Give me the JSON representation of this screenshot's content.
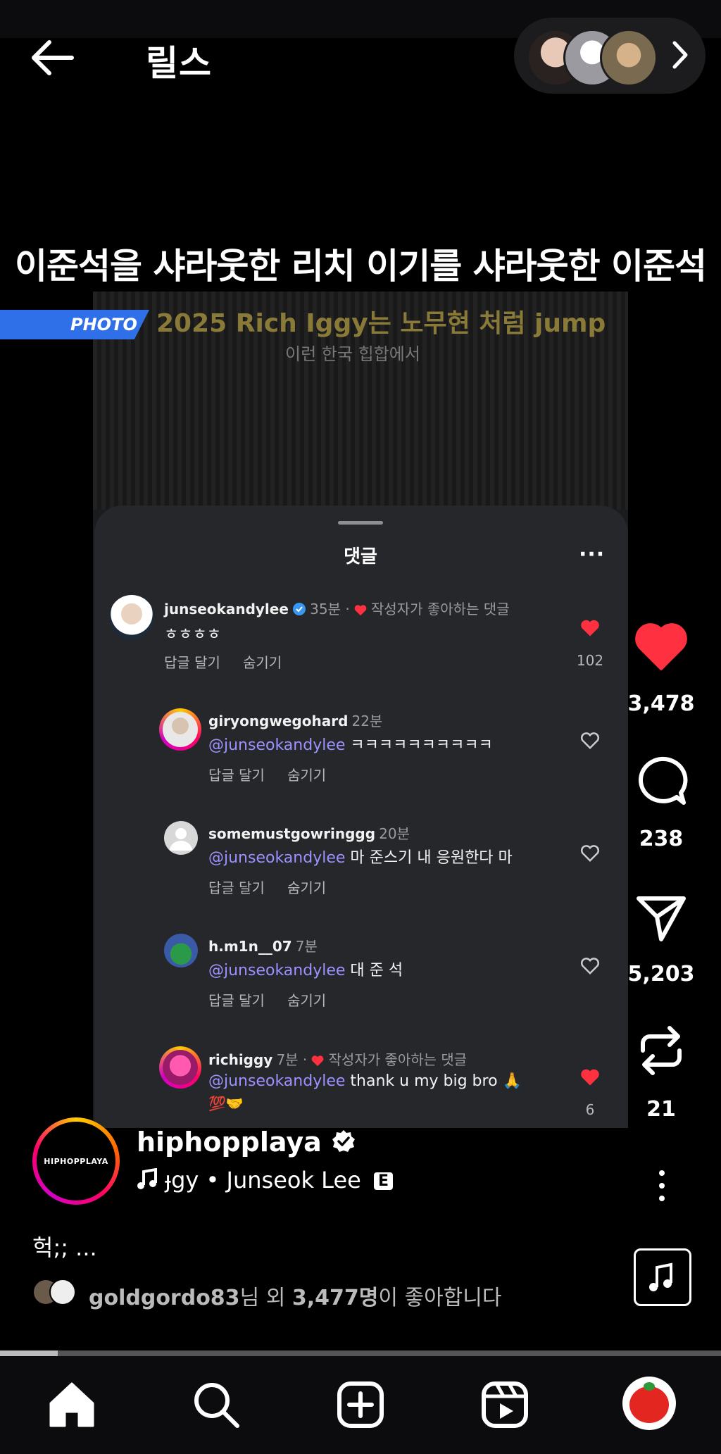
{
  "header": {
    "title": "릴스",
    "back_icon": "arrow-left-icon",
    "chevron_icon": "chevron-right-icon"
  },
  "headline": "이준석을 샤라웃한 리치 이기를 샤라웃한 이준석",
  "video": {
    "photo_tag": "PHOTO",
    "overlay_line1": "2025 Rich Iggy는 노무현 처럼 jump",
    "overlay_line2": "이런 한국 힙합에서"
  },
  "comments_sheet": {
    "title": "댓글",
    "more_label": "···",
    "comments": [
      {
        "user": "junseokandylee",
        "time": "35분 ·",
        "liked_by_creator": "작성자가 좋아하는 댓글",
        "mention": "",
        "text": "ㅎㅎㅎㅎ",
        "reply": "답글 달기",
        "hide": "숨기기",
        "likes": "102"
      },
      {
        "user": "giryongwegohard",
        "time": "22분",
        "liked_by_creator": "",
        "mention": "@junseokandylee",
        "text": "ㅋㅋㅋㅋㅋㅋㅋㅋㅋㅋ",
        "reply": "답글 달기",
        "hide": "숨기기",
        "likes": ""
      },
      {
        "user": "somemustgowringgg",
        "time": "20분",
        "liked_by_creator": "",
        "mention": "@junseokandylee",
        "text": "마 준스기 내 응원한다 마",
        "reply": "답글 달기",
        "hide": "숨기기",
        "likes": ""
      },
      {
        "user": "h.m1n__07",
        "time": "7분",
        "liked_by_creator": "",
        "mention": "@junseokandylee",
        "text": "대 준 석",
        "reply": "답글 달기",
        "hide": "숨기기",
        "likes": ""
      },
      {
        "user": "richiggy",
        "time": "7분 ·",
        "liked_by_creator": "작성자가 좋아하는 댓글",
        "mention": "@junseokandylee",
        "text": "thank u my big bro 🙏",
        "text2": "💯🤝",
        "reply": "",
        "hide": "",
        "likes": "6"
      }
    ]
  },
  "rail": {
    "likes": "3,478",
    "comments": "238",
    "shares": "5,203",
    "reposts": "21"
  },
  "post": {
    "channel_logo": "HIPHOPPLAYA",
    "channel": "hiphopplaya",
    "music": "ɟgy • Junseok Lee",
    "explicit": "E",
    "caption": "헉;; ...",
    "likes_user": "goldgordo83",
    "likes_mid": "님 외 ",
    "likes_count": "3,477명",
    "likes_tail": "이 좋아합니다"
  },
  "progress": 0.08,
  "colors": {
    "heart": "#ff3040",
    "mention": "#9b92ff",
    "photo_tag": "#2f6fe8"
  },
  "nav": [
    "home-icon",
    "search-icon",
    "create-icon",
    "reels-icon",
    "profile-icon"
  ]
}
